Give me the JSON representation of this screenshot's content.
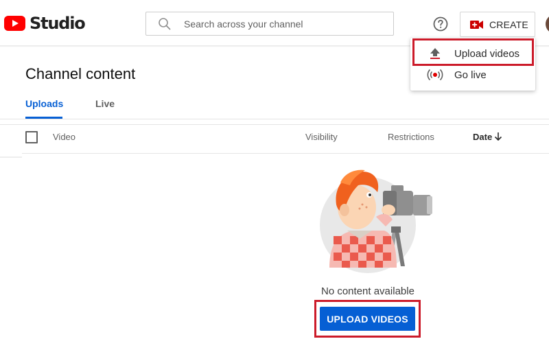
{
  "app": {
    "name": "Studio"
  },
  "header": {
    "search_placeholder": "Search across your channel",
    "create_label": "CREATE",
    "icons": {
      "logo": "youtube-play-icon",
      "search": "search-icon",
      "help": "help-icon",
      "create": "video-camera-plus-icon",
      "avatar": "avatar"
    }
  },
  "create_menu": {
    "items": [
      {
        "label": "Upload videos",
        "icon": "upload-icon"
      },
      {
        "label": "Go live",
        "icon": "live-broadcast-icon"
      }
    ]
  },
  "page": {
    "title": "Channel content",
    "tabs": [
      {
        "label": "Uploads",
        "active": true
      },
      {
        "label": "Live",
        "active": false
      }
    ]
  },
  "table": {
    "columns": [
      "Video",
      "Visibility",
      "Restrictions",
      "Date"
    ],
    "sorted_column": "Date",
    "sort_direction": "descending"
  },
  "empty_state": {
    "message": "No content available",
    "button_label": "UPLOAD VIDEOS"
  },
  "colors": {
    "brand_red": "#ff0000",
    "accent_blue": "#065fd4",
    "annotation_red": "#cc1b2a"
  }
}
